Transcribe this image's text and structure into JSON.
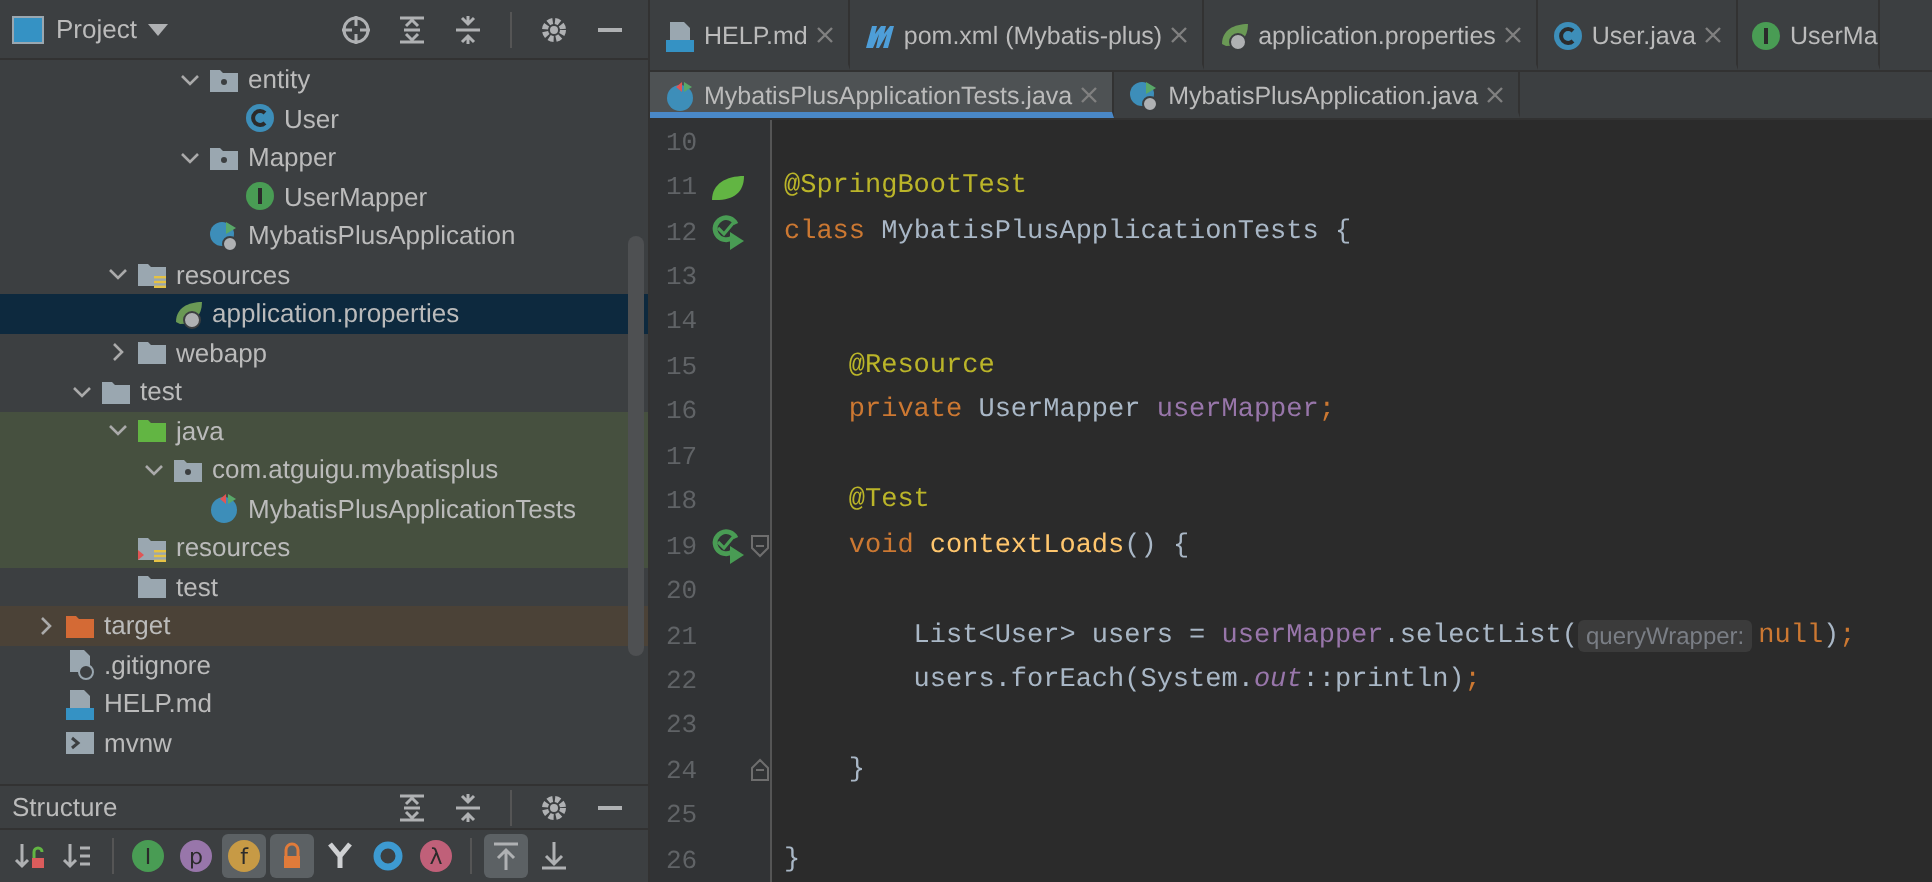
{
  "project_panel": {
    "title": "Project",
    "tree": [
      {
        "children": [
          {
            "children": [
              {
                "children": [
                  {
                    "children": [
                      {
                        "label": "entity",
                        "kind": "package",
                        "expanded": true,
                        "selected": false,
                        "children": [
                          {
                            "label": "User",
                            "kind": "class",
                            "selected": false
                          }
                        ]
                      },
                      {
                        "label": "Mapper",
                        "kind": "package",
                        "expanded": true,
                        "selected": false,
                        "children": [
                          {
                            "label": "UserMapper",
                            "kind": "interface",
                            "selected": false
                          }
                        ]
                      },
                      {
                        "label": "MybatisPlusApplication",
                        "kind": "app",
                        "selected": false
                      }
                    ]
                  }
                ]
              },
              {
                "label": "resources",
                "kind": "resources",
                "expanded": true,
                "selected": false,
                "children": [
                  {
                    "label": "application.properties",
                    "kind": "properties",
                    "selected": true
                  }
                ]
              },
              {
                "label": "webapp",
                "kind": "folder",
                "expanded": false,
                "selected": false
              }
            ]
          },
          {
            "label": "test",
            "kind": "folder",
            "expanded": true,
            "selected": false,
            "children": [
              {
                "label": "java",
                "kind": "testsource",
                "expanded": true,
                "selected": false,
                "color": "#46503f",
                "children": [
                  {
                    "label": "com.atguigu.mybatisplus",
                    "kind": "package",
                    "expanded": true,
                    "selected": false,
                    "color": "#46503f",
                    "children": [
                      {
                        "label": "MybatisPlusApplicationTests",
                        "kind": "testclass",
                        "selected": false,
                        "color": "#46503f"
                      }
                    ]
                  }
                ]
              },
              {
                "label": "resources",
                "kind": "testresources",
                "selected": false,
                "color": "#46503f"
              },
              {
                "label": "test",
                "kind": "folder",
                "selected": false
              }
            ]
          }
        ]
      },
      {
        "label": "target",
        "kind": "excluded",
        "expanded": false,
        "selected": false,
        "color": "#4b4237"
      },
      {
        "label": ".gitignore",
        "kind": "ignore",
        "selected": false
      },
      {
        "label": "HELP.md",
        "kind": "markdown",
        "selected": false
      },
      {
        "label": "mvnw",
        "kind": "script",
        "selected": false
      }
    ]
  },
  "structure_panel": {
    "title": "Structure",
    "tool_groups": [
      [
        {
          "kind": "visibility",
          "selected": false
        },
        {
          "kind": "alpha",
          "selected": false
        }
      ],
      [
        {
          "kind": "letter",
          "glyph": "I",
          "color": "#499c54",
          "selected": false
        },
        {
          "kind": "letter",
          "glyph": "p",
          "color": "#9876aa",
          "selected": false
        },
        {
          "kind": "letter",
          "glyph": "f",
          "color": "#c79a45",
          "selected": true
        },
        {
          "kind": "lock",
          "selected": true
        },
        {
          "kind": "fork",
          "selected": false
        },
        {
          "kind": "ring",
          "selected": false
        },
        {
          "kind": "letter",
          "glyph": "λ",
          "color": "#c06079",
          "selected": false
        }
      ],
      [
        {
          "kind": "scrollto",
          "selected": true
        },
        {
          "kind": "scrollfrom",
          "selected": false
        }
      ]
    ]
  },
  "tab_rows": [
    [
      {
        "label": "HELP.md",
        "kind": "markdown",
        "selected": false
      },
      {
        "label": "pom.xml (Mybatis-plus)",
        "kind": "maven",
        "selected": false
      },
      {
        "label": "application.properties",
        "kind": "properties",
        "selected": false
      },
      {
        "label": "User.java",
        "kind": "class",
        "selected": false
      },
      {
        "label": "UserMa",
        "kind": "interface",
        "selected": false
      }
    ],
    [
      {
        "label": "MybatisPlusApplicationTests.java",
        "kind": "testclass",
        "selected": true
      },
      {
        "label": "MybatisPlusApplication.java",
        "kind": "app",
        "selected": false
      }
    ]
  ],
  "editor": {
    "lines": [
      {
        "number": "10",
        "kind": "plain"
      },
      {
        "number": "11",
        "kind": "spring",
        "tokens": [
          {
            "kind": "annotation",
            "text": "@SpringBootTest"
          }
        ]
      },
      {
        "number": "12",
        "kind": "run",
        "tokens": [
          {
            "kind": "keyword",
            "text": "class"
          },
          {
            "kind": "plain",
            "text": " MybatisPlusApplicationTests {"
          }
        ]
      },
      {
        "number": "13",
        "kind": "plain"
      },
      {
        "number": "14",
        "kind": "plain"
      },
      {
        "number": "15",
        "kind": "plain",
        "tokens": [
          {
            "kind": "annotation",
            "text": "    @Resource"
          }
        ]
      },
      {
        "number": "16",
        "kind": "plain",
        "tokens": [
          {
            "kind": "keyword",
            "text": "    private"
          },
          {
            "kind": "plain",
            "text": " UserMapper "
          },
          {
            "kind": "field",
            "text": "userMapper"
          },
          {
            "kind": "keyword",
            "text": ";"
          }
        ]
      },
      {
        "number": "17",
        "kind": "plain"
      },
      {
        "number": "18",
        "kind": "plain",
        "tokens": [
          {
            "kind": "annotation",
            "text": "    @Test"
          }
        ]
      },
      {
        "number": "19",
        "kind": "runfold",
        "tokens": [
          {
            "kind": "keyword",
            "text": "    void "
          },
          {
            "kind": "method",
            "text": "contextLoads"
          },
          {
            "kind": "plain",
            "text": "() {"
          }
        ]
      },
      {
        "number": "20",
        "kind": "plain"
      },
      {
        "number": "21",
        "kind": "plain",
        "tokens": [
          {
            "kind": "plain",
            "text": "        List<User> users = "
          },
          {
            "kind": "field",
            "text": "userMapper"
          },
          {
            "kind": "plain",
            "text": ".selectList("
          },
          {
            "kind": "hint",
            "text": "queryWrapper:"
          },
          {
            "kind": "keyword",
            "text": "null"
          },
          {
            "kind": "plain",
            "text": ")"
          },
          {
            "kind": "keyword",
            "text": ";"
          }
        ]
      },
      {
        "number": "22",
        "kind": "plain",
        "tokens": [
          {
            "kind": "plain",
            "text": "        users.forEach(System."
          },
          {
            "kind": "static",
            "text": "out"
          },
          {
            "kind": "plain",
            "text": "::println)"
          },
          {
            "kind": "keyword",
            "text": ";"
          }
        ]
      },
      {
        "number": "23",
        "kind": "plain"
      },
      {
        "number": "24",
        "kind": "foldend",
        "tokens": [
          {
            "kind": "plain",
            "text": "    }"
          }
        ]
      },
      {
        "number": "25",
        "kind": "plain"
      },
      {
        "number": "26",
        "kind": "plain",
        "tokens": [
          {
            "kind": "plain",
            "text": "}"
          }
        ]
      }
    ]
  }
}
